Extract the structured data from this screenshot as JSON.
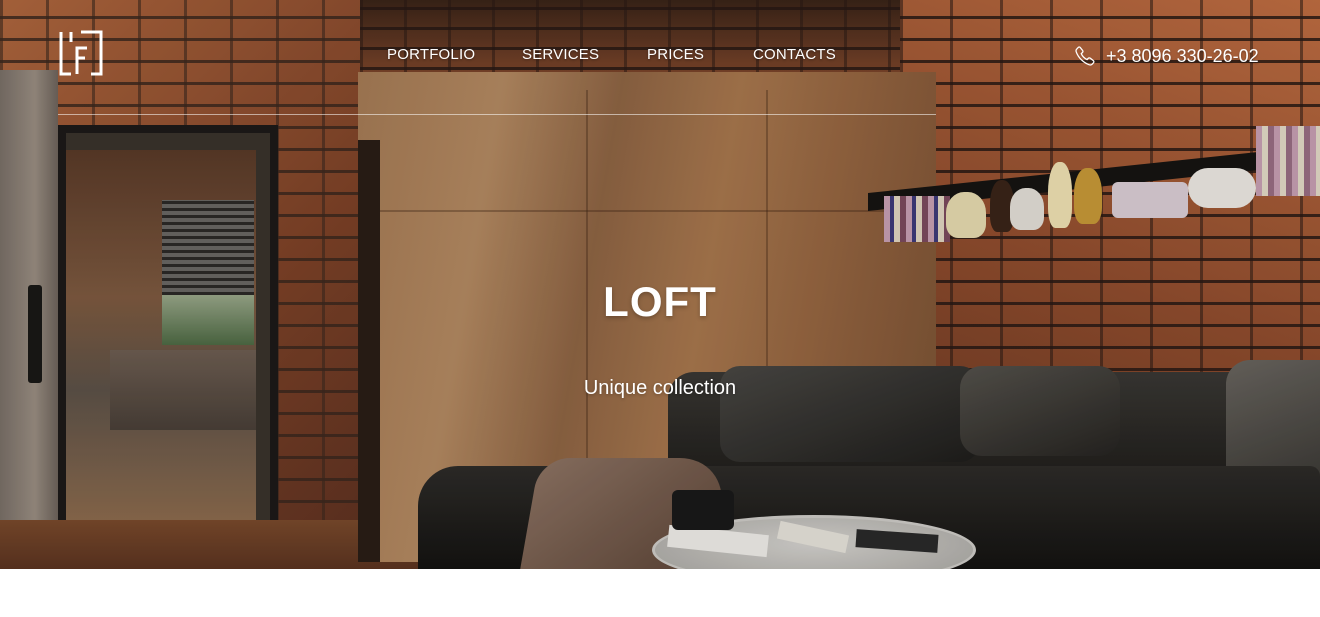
{
  "brand": {
    "logo_icon": "lfd-monogram-logo"
  },
  "nav": {
    "items": [
      {
        "label": "PORTFOLIO"
      },
      {
        "label": "SERVICES"
      },
      {
        "label": "PRICES"
      },
      {
        "label": "CONTACTS"
      }
    ]
  },
  "contact": {
    "phone_icon": "phone-icon",
    "phone": "+3 8096 330-26-02"
  },
  "hero": {
    "title": "LOFT",
    "subtitle": "Unique collection"
  },
  "colors": {
    "text": "#ffffff",
    "page_background": "#ffffff"
  }
}
